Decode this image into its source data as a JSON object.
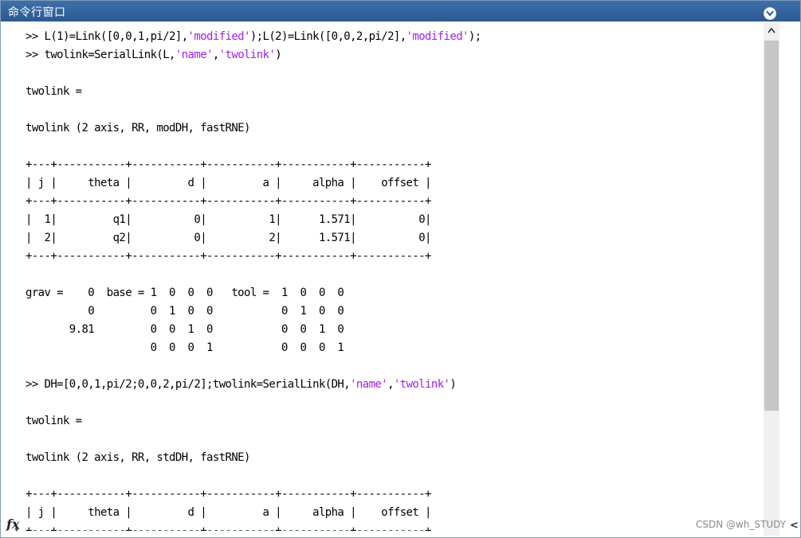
{
  "window": {
    "title": "命令行窗口"
  },
  "icons": {
    "menu": "chevron-down-circle-icon",
    "function": "fx-icon",
    "scroll": "scroll-up-arrow-icon"
  },
  "colors": {
    "titlebar": "#2f5f9a",
    "string": "#a020f0",
    "scroll_thumb": "#c6c6c6"
  },
  "prompt": {
    "fx_label": "fx"
  },
  "lines": [
    {
      "pre": ">> L(1)=Link([0,0,1,pi/2],",
      "s1": "'modified'",
      "mid": ");L(2)=Link([0,0,2,pi/2],",
      "s2": "'modified'",
      "post": ");"
    },
    {
      "pre": ">> twolink=SerialLink(L,",
      "s1": "'name'",
      "mid": ",",
      "s2": "'twolink'",
      "post": ")"
    },
    {
      "text": ""
    },
    {
      "text": "twolink ="
    },
    {
      "text": ""
    },
    {
      "text": "twolink (2 axis, RR, modDH, fastRNE)"
    },
    {
      "text": ""
    },
    {
      "text": "+---+-----------+-----------+-----------+-----------+-----------+"
    },
    {
      "text": "| j |     theta |         d |         a |     alpha |    offset |"
    },
    {
      "text": "+---+-----------+-----------+-----------+-----------+-----------+"
    },
    {
      "text": "|  1|         q1|          0|          1|      1.571|          0|"
    },
    {
      "text": "|  2|         q2|          0|          2|      1.571|          0|"
    },
    {
      "text": "+---+-----------+-----------+-----------+-----------+-----------+"
    },
    {
      "text": ""
    },
    {
      "text": "grav =    0  base = 1  0  0  0   tool =  1  0  0  0"
    },
    {
      "text": "          0         0  1  0  0           0  1  0  0"
    },
    {
      "text": "       9.81         0  0  1  0           0  0  1  0"
    },
    {
      "text": "                    0  0  0  1           0  0  0  1"
    },
    {
      "text": ""
    },
    {
      "pre": ">> DH=[0,0,1,pi/2;0,0,2,pi/2];twolink=SerialLink(DH,",
      "s1": "'name'",
      "mid": ",",
      "s2": "'twolink'",
      "post": ")"
    },
    {
      "text": ""
    },
    {
      "text": "twolink ="
    },
    {
      "text": ""
    },
    {
      "text": "twolink (2 axis, RR, stdDH, fastRNE)"
    },
    {
      "text": ""
    },
    {
      "text": "+---+-----------+-----------+-----------+-----------+-----------+"
    },
    {
      "text": "| j |     theta |         d |         a |     alpha |    offset |"
    },
    {
      "text": "+---+-----------+-----------+-----------+-----------+-----------+"
    }
  ],
  "watermark": "CSDN @wh_STUDY",
  "side_chevron": "<"
}
